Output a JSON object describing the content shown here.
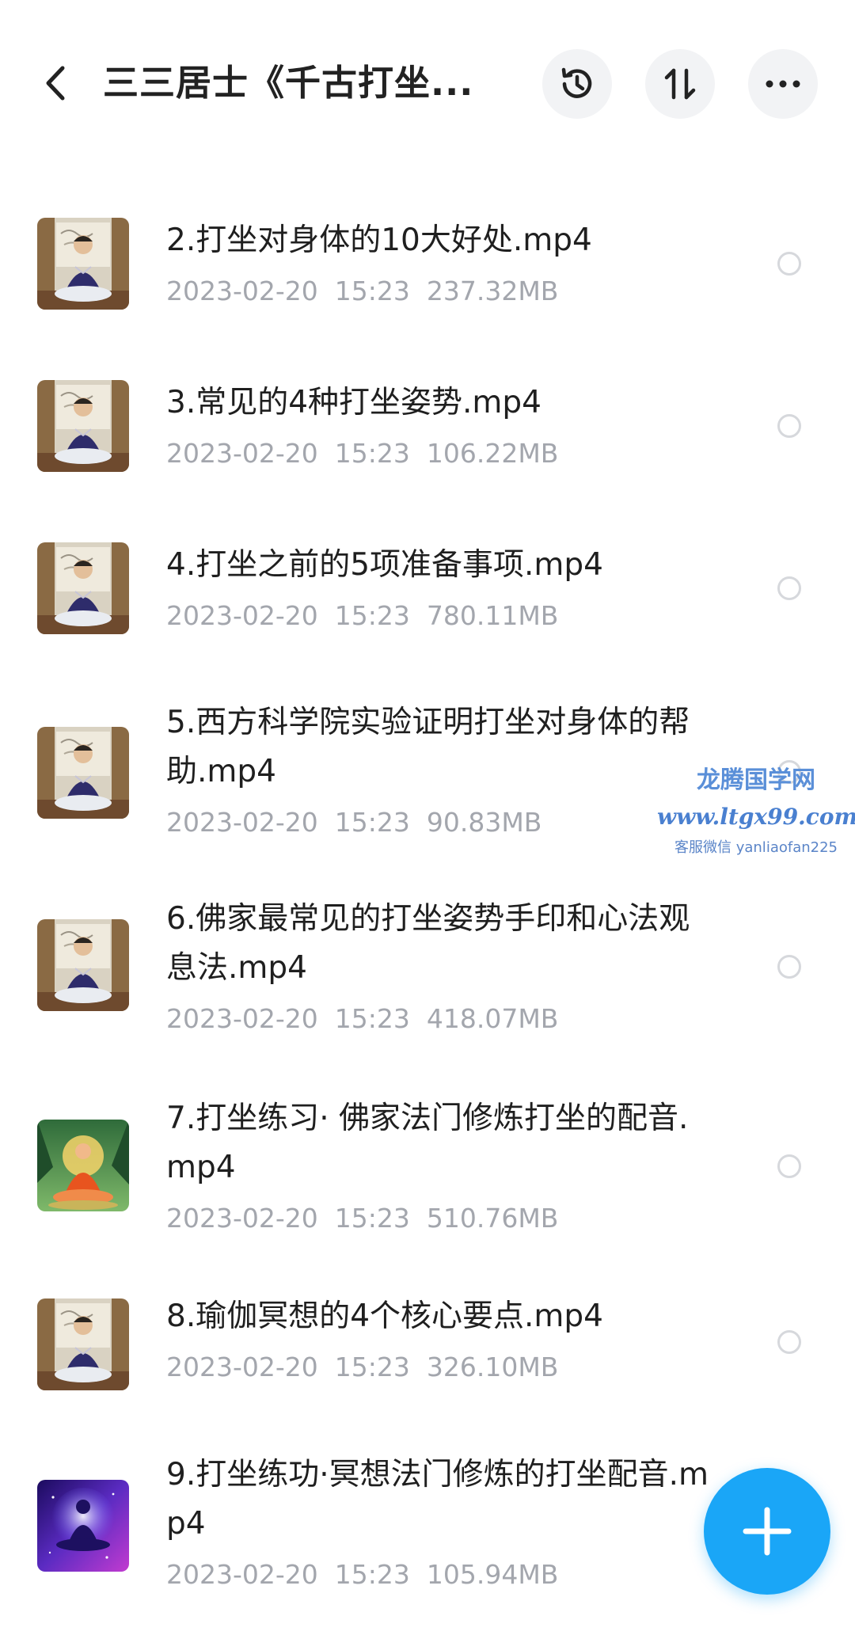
{
  "header": {
    "title": "三三居士《千古打坐..."
  },
  "icons": {
    "back": "back-arrow-icon",
    "history": "history-icon",
    "sort": "sort-icon",
    "more": "more-dots-icon",
    "add": "plus-icon"
  },
  "files": [
    {
      "name": "2.打坐对身体的10大好处.mp4",
      "date": "2023-02-20",
      "time": "15:23",
      "size": "237.32MB"
    },
    {
      "name": "3.常见的4种打坐姿势.mp4",
      "date": "2023-02-20",
      "time": "15:23",
      "size": "106.22MB"
    },
    {
      "name": "4.打坐之前的5项准备事项.mp4",
      "date": "2023-02-20",
      "time": "15:23",
      "size": "780.11MB"
    },
    {
      "name": "5.西方科学院实验证明打坐对身体的帮助.mp4",
      "date": "2023-02-20",
      "time": "15:23",
      "size": "90.83MB"
    },
    {
      "name": "6.佛家最常见的打坐姿势手印和心法观息法.mp4",
      "date": "2023-02-20",
      "time": "15:23",
      "size": "418.07MB"
    },
    {
      "name": "7.打坐练习· 佛家法门修炼打坐的配音.mp4",
      "date": "2023-02-20",
      "time": "15:23",
      "size": "510.76MB"
    },
    {
      "name": "8.瑜伽冥想的4个核心要点.mp4",
      "date": "2023-02-20",
      "time": "15:23",
      "size": "326.10MB"
    },
    {
      "name": "9.打坐练功·冥想法门修炼的打坐配音.mp4",
      "date": "2023-02-20",
      "time": "15:23",
      "size": "105.94MB"
    }
  ],
  "watermark": {
    "line1": "龙腾国学网",
    "line2": "www.ltgx99.com",
    "line3": "客服微信 yanliaofan225"
  },
  "colors": {
    "accent": "#1aa6f7",
    "meta_text": "#a3a6ad",
    "watermark": "#4a80d0"
  }
}
